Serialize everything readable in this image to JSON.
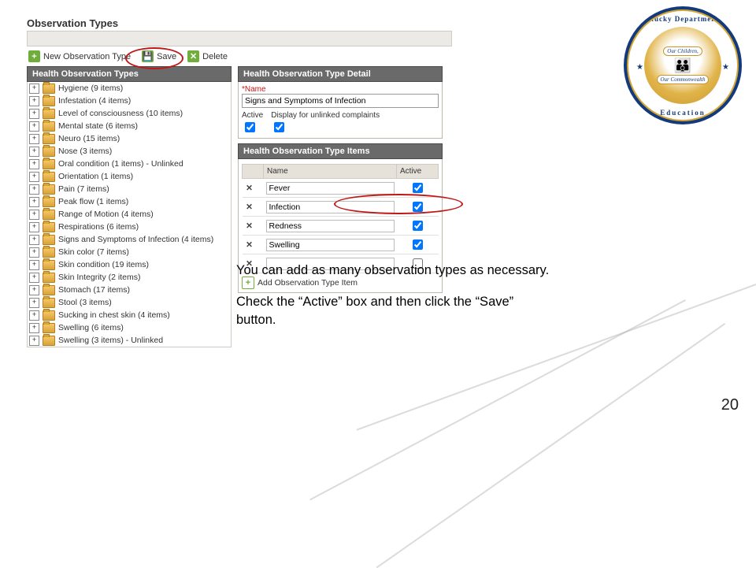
{
  "page_number": "20",
  "seal": {
    "ring_top": "Kentucky Department of",
    "ring_bottom": "Education",
    "banner_top": "Our Children,",
    "banner_bottom": "Our Commonwealth"
  },
  "app": {
    "title": "Observation Types",
    "toolbar": {
      "new_label": "New Observation Type",
      "save_label": "Save",
      "delete_label": "Delete"
    },
    "tree_header": "Health Observation Types",
    "tree": [
      "Hygiene (9 items)",
      "Infestation (4 items)",
      "Level of consciousness (10 items)",
      "Mental state (6 items)",
      "Neuro (15 items)",
      "Nose (3 items)",
      "Oral condition (1 items) - Unlinked",
      "Orientation (1 items)",
      "Pain (7 items)",
      "Peak flow (1 items)",
      "Range of Motion (4 items)",
      "Respirations (6 items)",
      "Signs and Symptoms of Infection (4 items)",
      "Skin color (7 items)",
      "Skin condition (19 items)",
      "Skin Integrity (2 items)",
      "Stomach (17 items)",
      "Stool (3 items)",
      "Sucking in chest skin (4 items)",
      "Swelling (6 items)",
      "Swelling (3 items) - Unlinked"
    ],
    "detail": {
      "header": "Health Observation Type Detail",
      "name_label": "*Name",
      "name_value": "Signs and Symptoms of Infection",
      "active_label": "Active",
      "display_label": "Display for unlinked complaints",
      "active_checked": true,
      "display_checked": true
    },
    "items": {
      "header": "Health Observation Type Items",
      "col_name": "Name",
      "col_active": "Active",
      "rows": [
        {
          "name": "Fever",
          "active": true
        },
        {
          "name": "Infection",
          "active": true
        },
        {
          "name": "Redness",
          "active": true
        },
        {
          "name": "Swelling",
          "active": true
        },
        {
          "name": "",
          "active": false
        }
      ],
      "add_label": "Add Observation Type Item"
    }
  },
  "instructions": {
    "p1": "You can add as many observation types as necessary.",
    "p2": "Check the “Active” box and then click the “Save” button."
  }
}
